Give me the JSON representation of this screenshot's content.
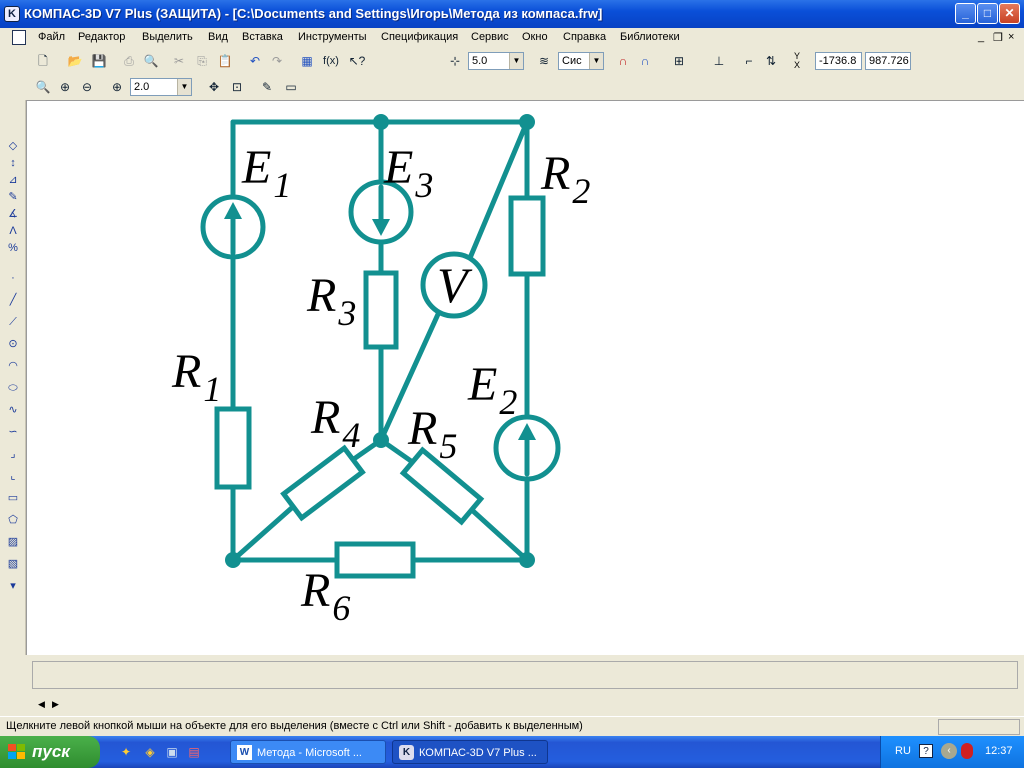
{
  "window": {
    "title": "КОМПАС-3D V7 Plus (ЗАЩИТА) - [C:\\Documents and Settings\\Игорь\\Метода из компаса.frw]",
    "controls": {
      "minimize": "_",
      "maximize": "□",
      "close": "✕"
    }
  },
  "menu": {
    "items": [
      "Файл",
      "Редактор",
      "Выделить",
      "Вид",
      "Вставка",
      "Инструменты",
      "Спецификация",
      "Сервис",
      "Окно",
      "Справка",
      "Библиотеки"
    ],
    "doc_controls": {
      "minimize": "_",
      "restore": "❐",
      "close": "×"
    }
  },
  "toolbar": {
    "step_value": "5.0",
    "style_value": "Сис",
    "coord_y_label": "Y",
    "coord_x_label": "X",
    "coord_x_value": "-1736.8",
    "coord_y_value": "987.726",
    "fx_label": "f(x)"
  },
  "view_toolbar": {
    "zoom_value": "2.0"
  },
  "circuit": {
    "color": "#129090",
    "labels": {
      "E1": {
        "main": "E",
        "sub": "1"
      },
      "E2": {
        "main": "E",
        "sub": "2"
      },
      "E3": {
        "main": "E",
        "sub": "3"
      },
      "R1": {
        "main": "R",
        "sub": "1"
      },
      "R2": {
        "main": "R",
        "sub": "2"
      },
      "R3": {
        "main": "R",
        "sub": "3"
      },
      "R4": {
        "main": "R",
        "sub": "4"
      },
      "R5": {
        "main": "R",
        "sub": "5"
      },
      "R6": {
        "main": "R",
        "sub": "6"
      },
      "V": {
        "main": "V"
      }
    }
  },
  "status": {
    "hint": "Щелкните левой кнопкой мыши на объекте для его выделения (вместе с Ctrl или Shift - добавить к выделенным)"
  },
  "taskbar": {
    "start_label": "пуск",
    "tasks": [
      "Метода - Microsoft ...",
      "КОМПАС-3D V7 Plus ..."
    ],
    "language": "RU",
    "clock": "12:37"
  }
}
